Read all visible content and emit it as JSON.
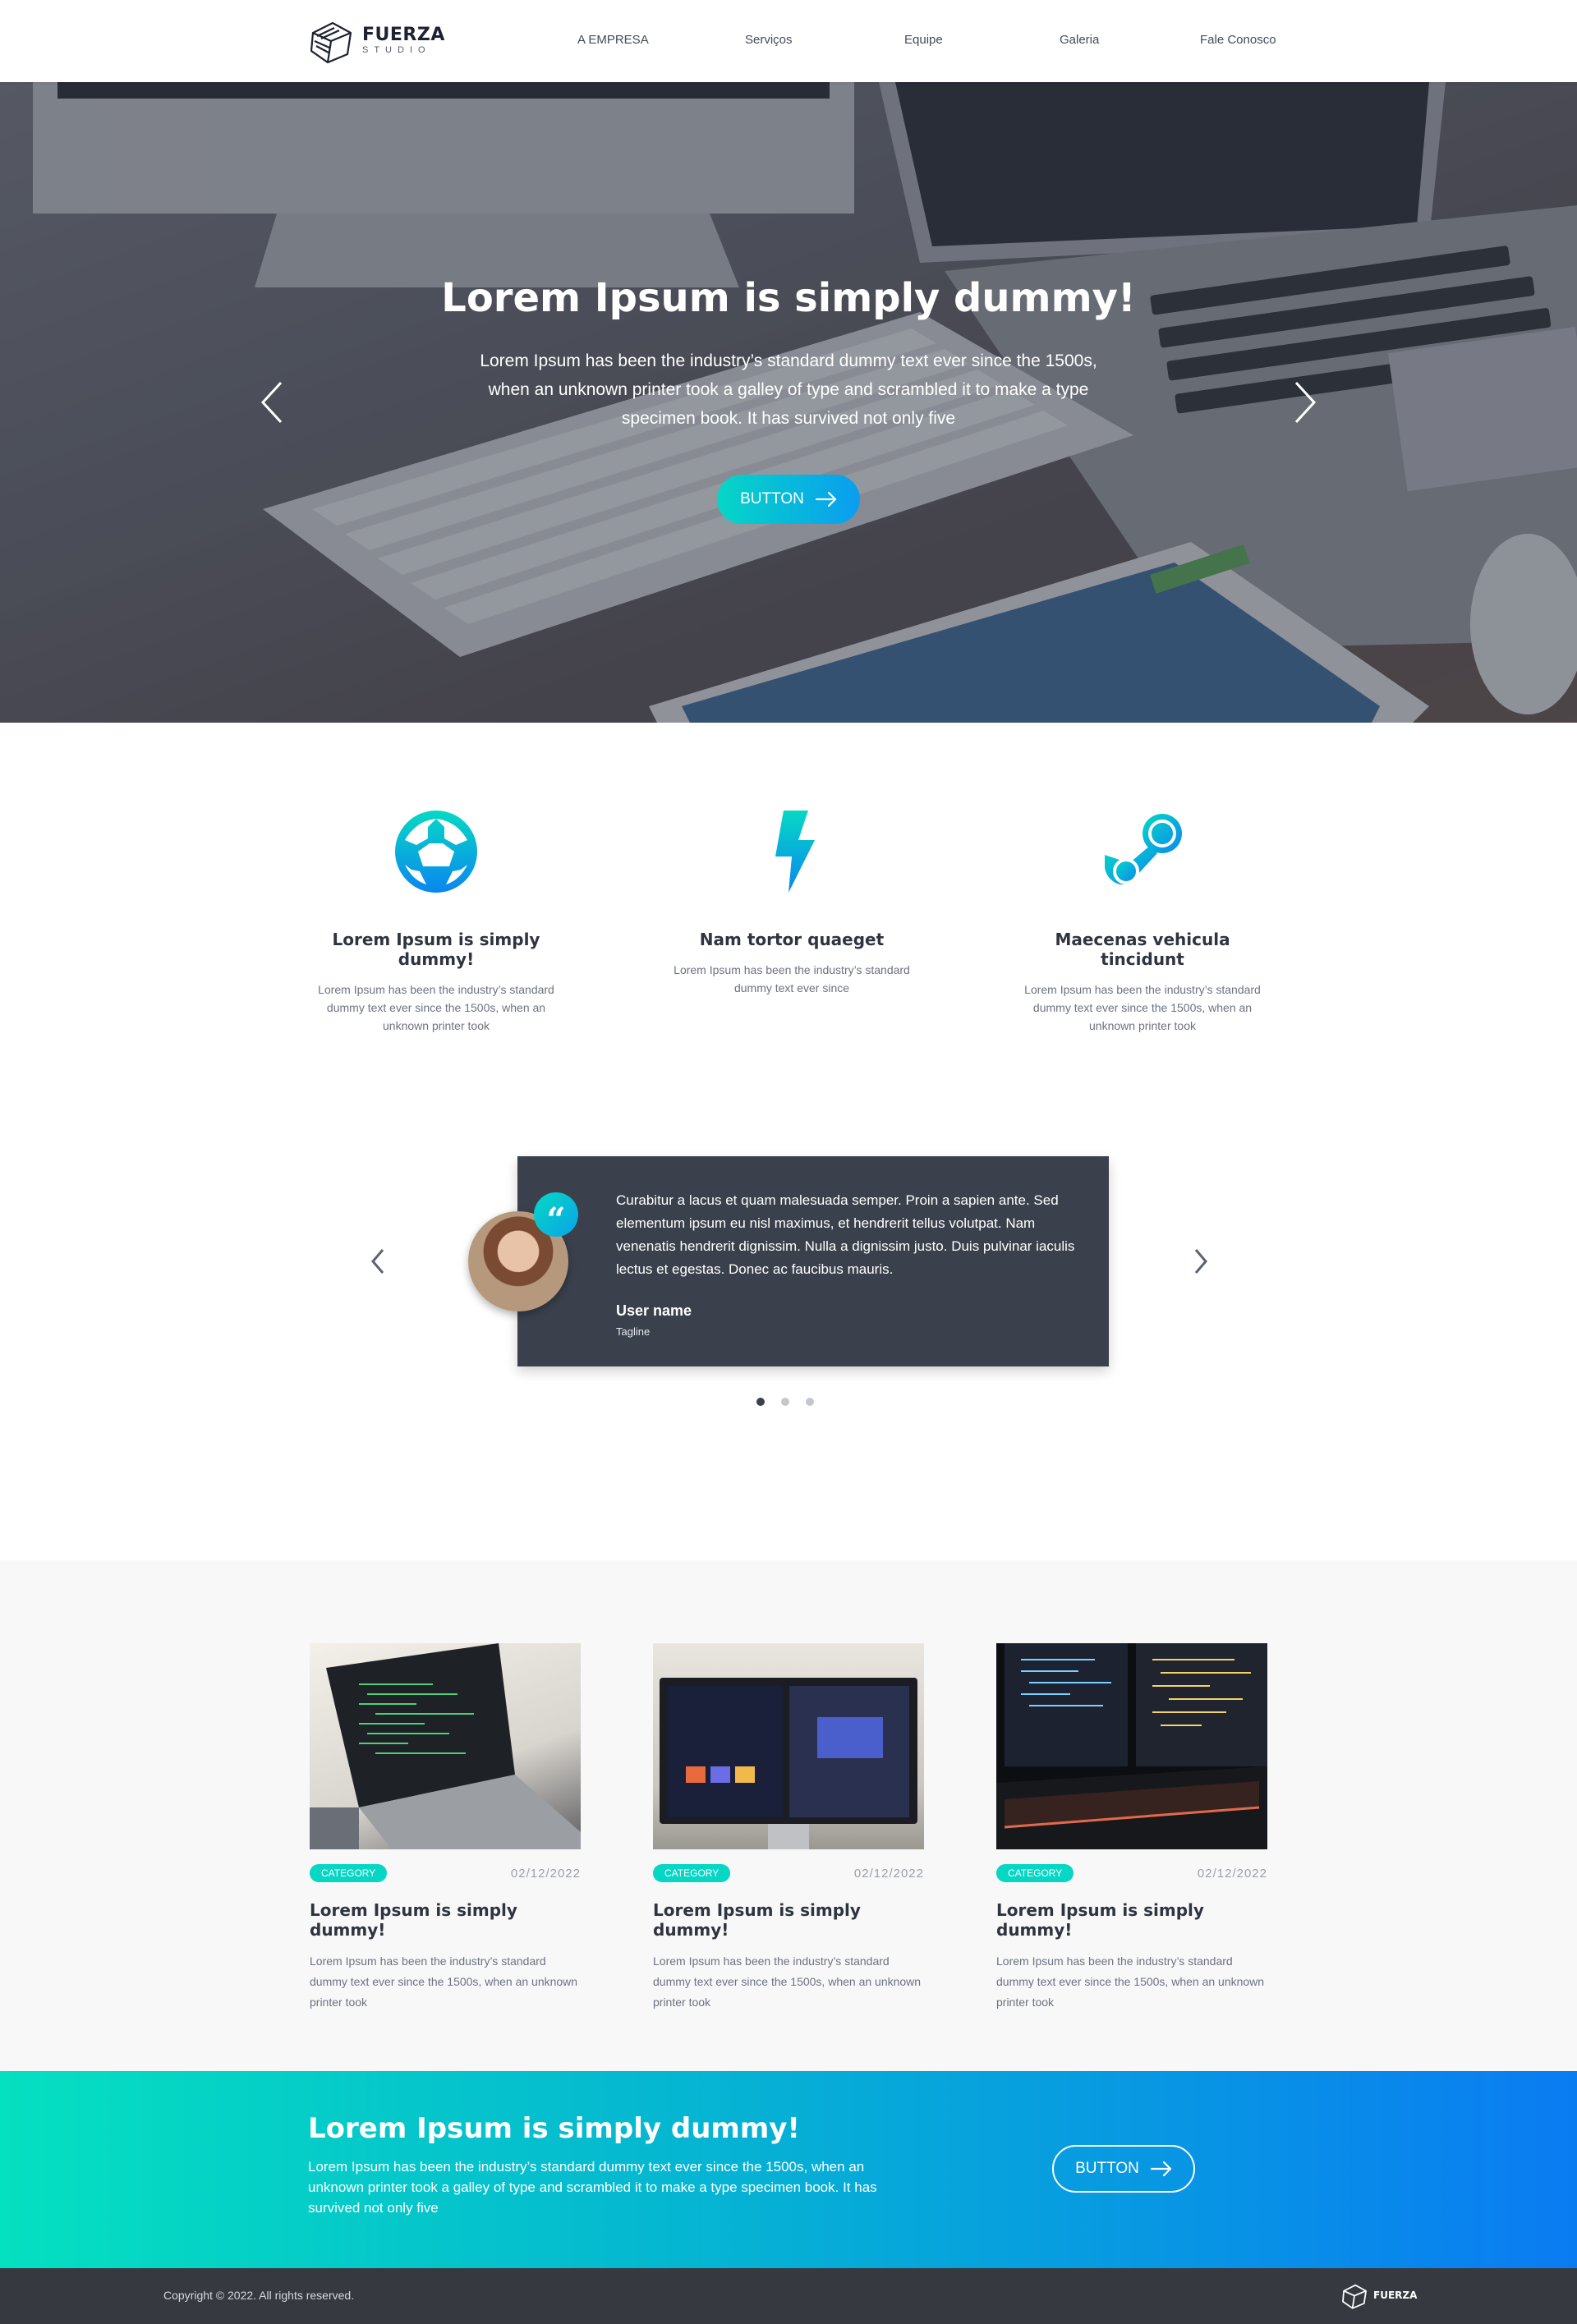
{
  "brand": {
    "name": "FUERZA",
    "sub": "STUDIO"
  },
  "nav": [
    "A EMPRESA",
    "Serviços",
    "Equipe",
    "Galeria",
    "Fale Conosco"
  ],
  "hero": {
    "title": "Lorem Ipsum is simply dummy!",
    "text": "Lorem Ipsum has been the industry’s standard dummy text ever since the 1500s, when an unknown printer took a galley of type and scrambled it to make a type specimen book. It has survived not only five",
    "button": "BUTTON"
  },
  "features": [
    {
      "icon": "soccer-ball-icon",
      "title": "Lorem Ipsum is simply dummy!",
      "text": "Lorem Ipsum has been the industry’s standard dummy text ever since the 1500s, when an unknown printer took"
    },
    {
      "icon": "lightning-bolt-icon",
      "title": "Nam tortor quaeget",
      "text": "Lorem Ipsum has been the industry’s standard dummy text ever since"
    },
    {
      "icon": "steam-icon",
      "title": "Maecenas vehicula tincidunt",
      "text": "Lorem Ipsum has been the industry’s standard dummy text ever since the 1500s, when an unknown printer took"
    }
  ],
  "testimonial": {
    "quote": "Curabitur a lacus et quam malesuada semper. Proin a sapien ante. Sed elementum ipsum eu nisl maximus, et hendrerit tellus volutpat. Nam venenatis hendrerit dignissim. Nulla a dignissim justo. Duis pulvinar iaculis lectus et egestas. Donec ac faucibus mauris.",
    "user": "User name",
    "tagline": "Tagline",
    "active_slide": 1,
    "slide_count": 3
  },
  "posts": [
    {
      "category": "CATEGORY",
      "date": "02/12/2022",
      "title": "Lorem Ipsum is simply dummy!",
      "text": "Lorem Ipsum has been the industry’s standard dummy text ever since the 1500s, when an unknown printer took"
    },
    {
      "category": "CATEGORY",
      "date": "02/12/2022",
      "title": "Lorem Ipsum is simply dummy!",
      "text": "Lorem Ipsum has been the industry’s standard dummy text ever since the 1500s, when an unknown printer took"
    },
    {
      "category": "CATEGORY",
      "date": "02/12/2022",
      "title": "Lorem Ipsum is simply dummy!",
      "text": "Lorem Ipsum has been the industry’s standard dummy text ever since the 1500s, when an unknown printer took"
    }
  ],
  "cta": {
    "title": "Lorem Ipsum is simply dummy!",
    "text": "Lorem Ipsum has been the industry’s standard dummy text ever since the 1500s, when an unknown printer took a galley of type and scrambled it to make a type specimen book. It has survived not only five",
    "button": "BUTTON"
  },
  "footer": {
    "copyright": "Copyright © 2022. All rights reserved."
  },
  "colors": {
    "accent_start": "#05d6c6",
    "accent_end": "#0a7cf2",
    "dark": "#3a414d",
    "footer": "#363a40"
  }
}
